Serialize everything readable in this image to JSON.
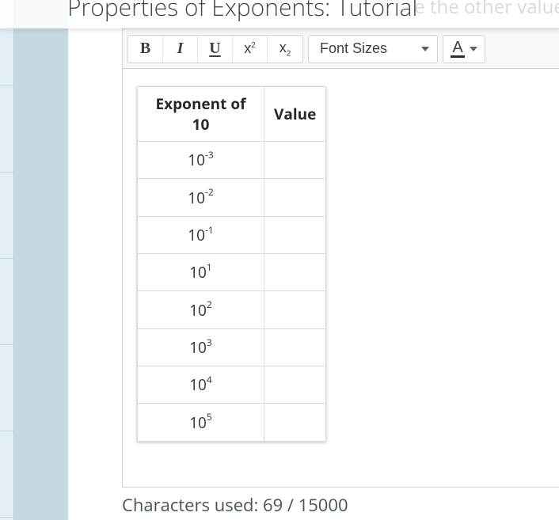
{
  "header": {
    "title": "Properties of Exponents: Tutorial",
    "ghost": "e the other values"
  },
  "toolbar": {
    "bold": "B",
    "italic": "I",
    "underline": "U",
    "superscript_base": "x",
    "superscript_exp": "2",
    "subscript_base": "x",
    "subscript_sub": "2",
    "font_sizes": "Font Sizes",
    "text_color": "A"
  },
  "table": {
    "headers": {
      "col1": "Exponent of 10",
      "col2": "Value"
    },
    "rows": [
      {
        "base": "10",
        "exp": "-3",
        "value": ""
      },
      {
        "base": "10",
        "exp": "-2",
        "value": ""
      },
      {
        "base": "10",
        "exp": "-1",
        "value": ""
      },
      {
        "base": "10",
        "exp": "1",
        "value": ""
      },
      {
        "base": "10",
        "exp": "2",
        "value": ""
      },
      {
        "base": "10",
        "exp": "3",
        "value": ""
      },
      {
        "base": "10",
        "exp": "4",
        "value": ""
      },
      {
        "base": "10",
        "exp": "5",
        "value": ""
      }
    ]
  },
  "footer": {
    "char_count": "Characters used: 69 / 15000"
  }
}
